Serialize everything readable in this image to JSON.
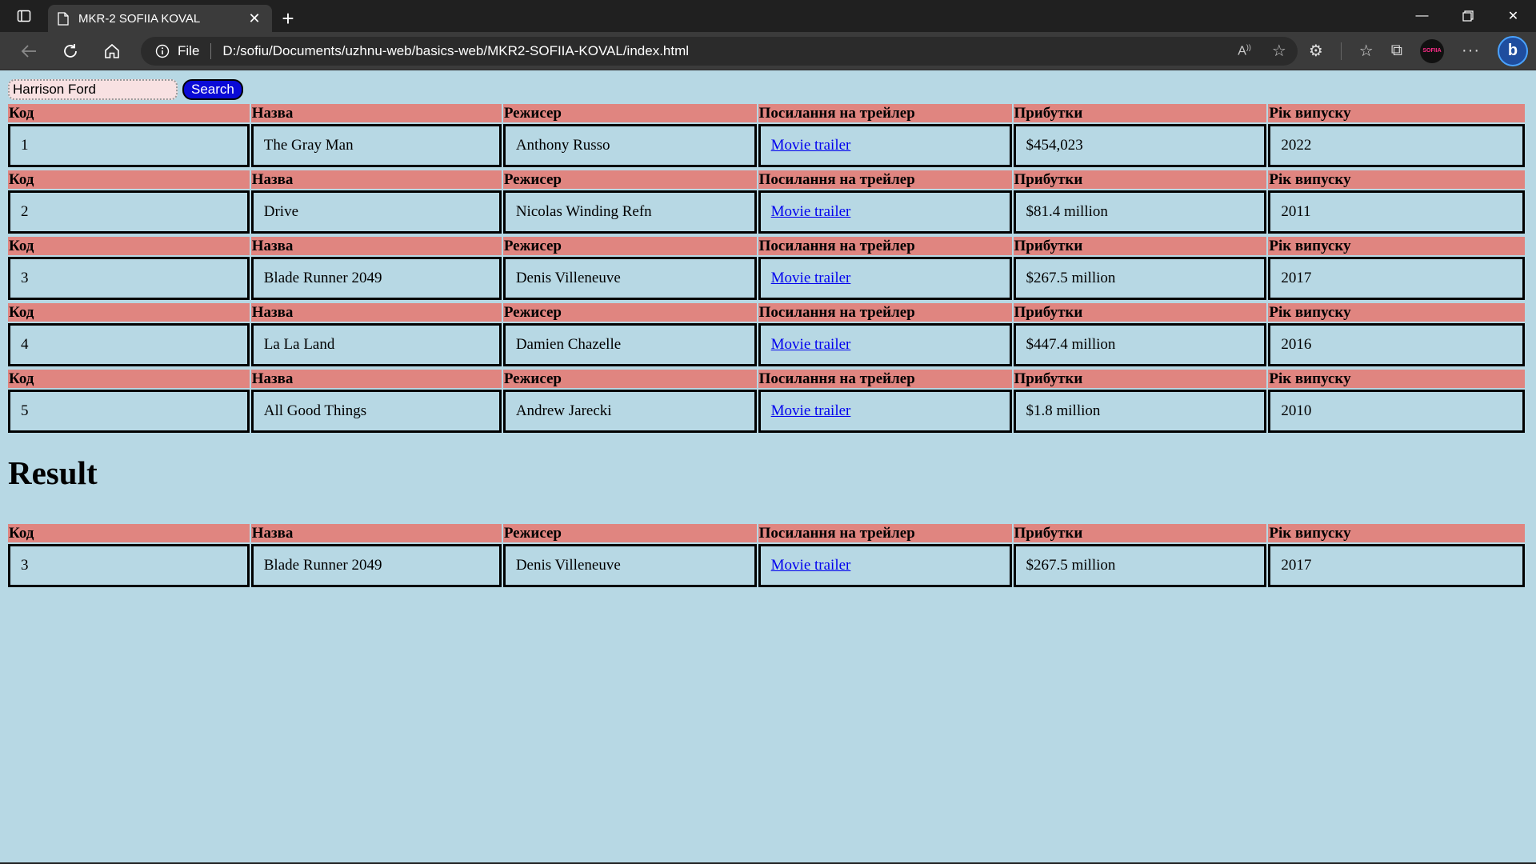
{
  "browser": {
    "tab_title": "MKR-2 SOFIIA KOVAL",
    "site_info_label": "File",
    "url": "D:/sofiu/Documents/uzhnu-web/basics-web/MKR2-SOFIIA-KOVAL/index.html",
    "profile_label": "SOFIIA"
  },
  "search": {
    "value": "Harrison Ford",
    "button_label": "Search"
  },
  "headers": [
    "Код",
    "Назва",
    "Режисер",
    "Посилання на трейлер",
    "Прибутки",
    "Рік випуску"
  ],
  "movies": [
    {
      "code": "1",
      "title": "The Gray Man",
      "director": "Anthony Russo",
      "trailer": "Movie trailer",
      "profit": "$454,023",
      "year": "2022"
    },
    {
      "code": "2",
      "title": "Drive",
      "director": "Nicolas Winding Refn",
      "trailer": "Movie trailer",
      "profit": "$81.4 million",
      "year": "2011"
    },
    {
      "code": "3",
      "title": "Blade Runner 2049",
      "director": "Denis Villeneuve",
      "trailer": "Movie trailer",
      "profit": "$267.5 million",
      "year": "2017"
    },
    {
      "code": "4",
      "title": "La La Land",
      "director": "Damien Chazelle",
      "trailer": "Movie trailer",
      "profit": "$447.4 million",
      "year": "2016"
    },
    {
      "code": "5",
      "title": "All Good Things",
      "director": "Andrew Jarecki",
      "trailer": "Movie trailer",
      "profit": "$1.8 million",
      "year": "2010"
    }
  ],
  "result_heading": "Result",
  "results": [
    {
      "code": "3",
      "title": "Blade Runner 2049",
      "director": "Denis Villeneuve",
      "trailer": "Movie trailer",
      "profit": "$267.5 million",
      "year": "2017"
    }
  ]
}
